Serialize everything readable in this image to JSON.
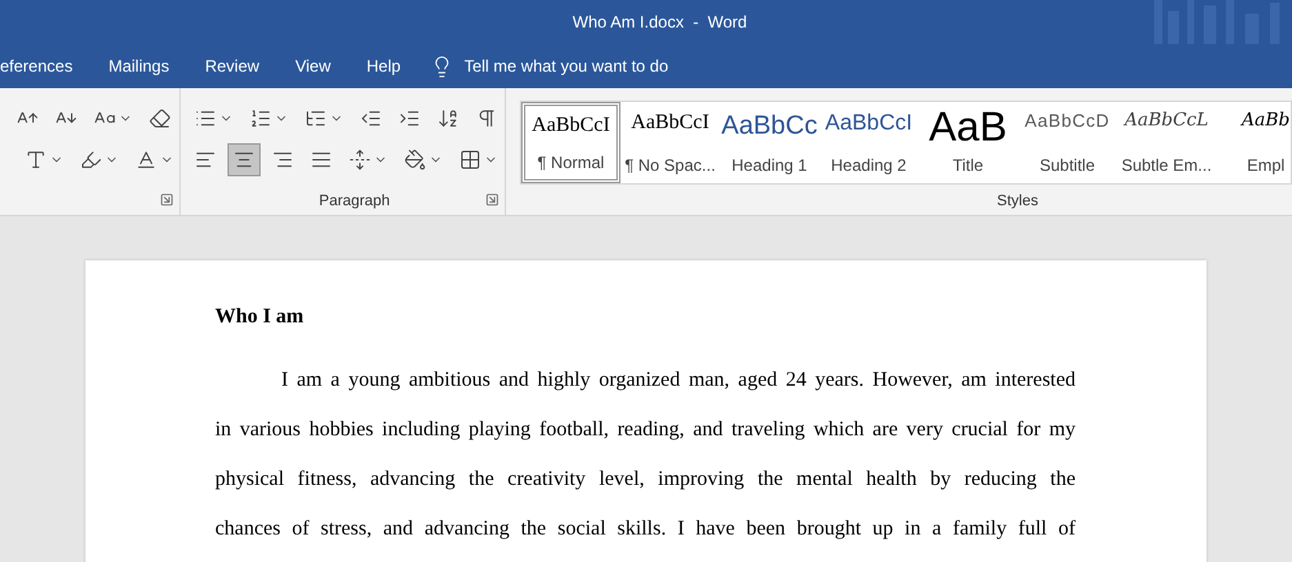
{
  "window": {
    "title": "Who Am I.docx  -  Word"
  },
  "tabs": [
    {
      "label": "eferences",
      "selected": false
    },
    {
      "label": "Mailings",
      "selected": false
    },
    {
      "label": "Review",
      "selected": false
    },
    {
      "label": "View",
      "selected": false
    },
    {
      "label": "Help",
      "selected": false
    }
  ],
  "tell_me": {
    "placeholder": "Tell me what you want to do"
  },
  "paragraph_group": {
    "label": "Paragraph",
    "alignment": [
      {
        "kind": "left",
        "selected": false
      },
      {
        "kind": "center",
        "selected": true
      },
      {
        "kind": "right",
        "selected": false
      },
      {
        "kind": "justify",
        "selected": false
      }
    ]
  },
  "styles_group": {
    "label": "Styles",
    "styles": [
      {
        "kind": "normal",
        "preview": "AaBbCcI",
        "label": "¶ Normal",
        "selected": true
      },
      {
        "kind": "nospacing",
        "preview": "AaBbCcI",
        "label": "¶ No Spac...",
        "selected": false
      },
      {
        "kind": "heading1",
        "preview": "AaBbCc",
        "label": "Heading 1",
        "selected": false
      },
      {
        "kind": "heading2",
        "preview": "AaBbCcI",
        "label": "Heading 2",
        "selected": false
      },
      {
        "kind": "title",
        "preview": "AaB",
        "label": "Title",
        "selected": false
      },
      {
        "kind": "subtitle",
        "preview": "AaBbCcD",
        "label": "Subtitle",
        "selected": false
      },
      {
        "kind": "subtle",
        "preview": "AaBbCcL",
        "label": "Subtle Em...",
        "selected": false
      },
      {
        "kind": "emphasis",
        "preview": "AaBb",
        "label": "Empl",
        "selected": false
      }
    ]
  },
  "document": {
    "heading": "Who I am",
    "lines": [
      "I am a young ambitious and highly organized man, aged 24 years. However, am interested",
      "in various hobbies including playing football, reading, and traveling which are very crucial for my",
      "physical fitness, advancing the creativity level, improving the mental health by reducing the",
      "chances of stress, and advancing the social skills. I have been brought up in a family full of"
    ]
  }
}
